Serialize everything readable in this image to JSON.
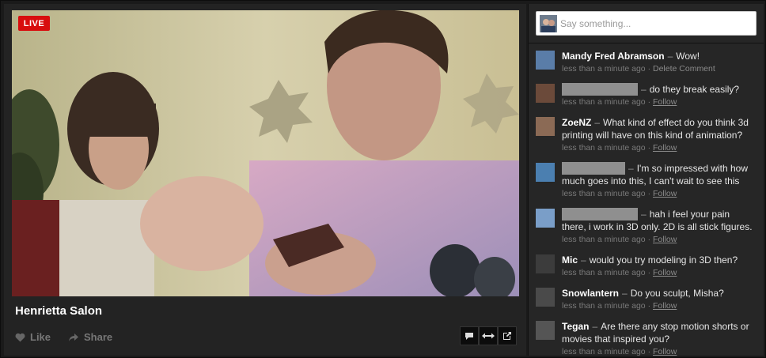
{
  "video": {
    "live_label": "LIVE",
    "title": "Henrietta Salon",
    "like_label": "Like",
    "share_label": "Share",
    "tools": [
      "comment-icon",
      "expand-horizontal-icon",
      "popout-icon"
    ]
  },
  "chat": {
    "placeholder": "Say something...",
    "comments": [
      {
        "name": "Mandy Fred Abramson",
        "redacted": false,
        "text": "Wow!",
        "time": "less than a minute ago",
        "action": "Delete Comment"
      },
      {
        "name": "",
        "redacted": true,
        "text": "do they break easily?",
        "time": "less than a minute ago",
        "action": "Follow"
      },
      {
        "name": "ZoeNZ",
        "redacted": false,
        "text": "What kind of effect do you think 3d printing will have on this kind of animation?",
        "time": "less than a minute ago",
        "action": "Follow"
      },
      {
        "name": "",
        "redacted": true,
        "text": "I'm so impressed with how much goes into this, I can't wait to see this",
        "time": "less than a minute ago",
        "action": "Follow"
      },
      {
        "name": "",
        "redacted": true,
        "text": "hah i feel your pain there, i work in 3D only. 2D is all stick figures.",
        "time": "less than a minute ago",
        "action": "Follow"
      },
      {
        "name": "Mic",
        "redacted": false,
        "text": "would you try modeling in 3D then?",
        "time": "less than a minute ago",
        "action": "Follow"
      },
      {
        "name": "Snowlantern",
        "redacted": false,
        "text": "Do you sculpt, Misha?",
        "time": "less than a minute ago",
        "action": "Follow"
      },
      {
        "name": "Tegan",
        "redacted": false,
        "text": "Are there any stop motion shorts or movies that inspired you?",
        "time": "less than a minute ago",
        "action": "Follow"
      }
    ]
  },
  "colors": {
    "live_red": "#d80e0e",
    "panel_bg": "#232323",
    "chat_bg": "#262626",
    "meta_text": "#7a7a7a"
  }
}
